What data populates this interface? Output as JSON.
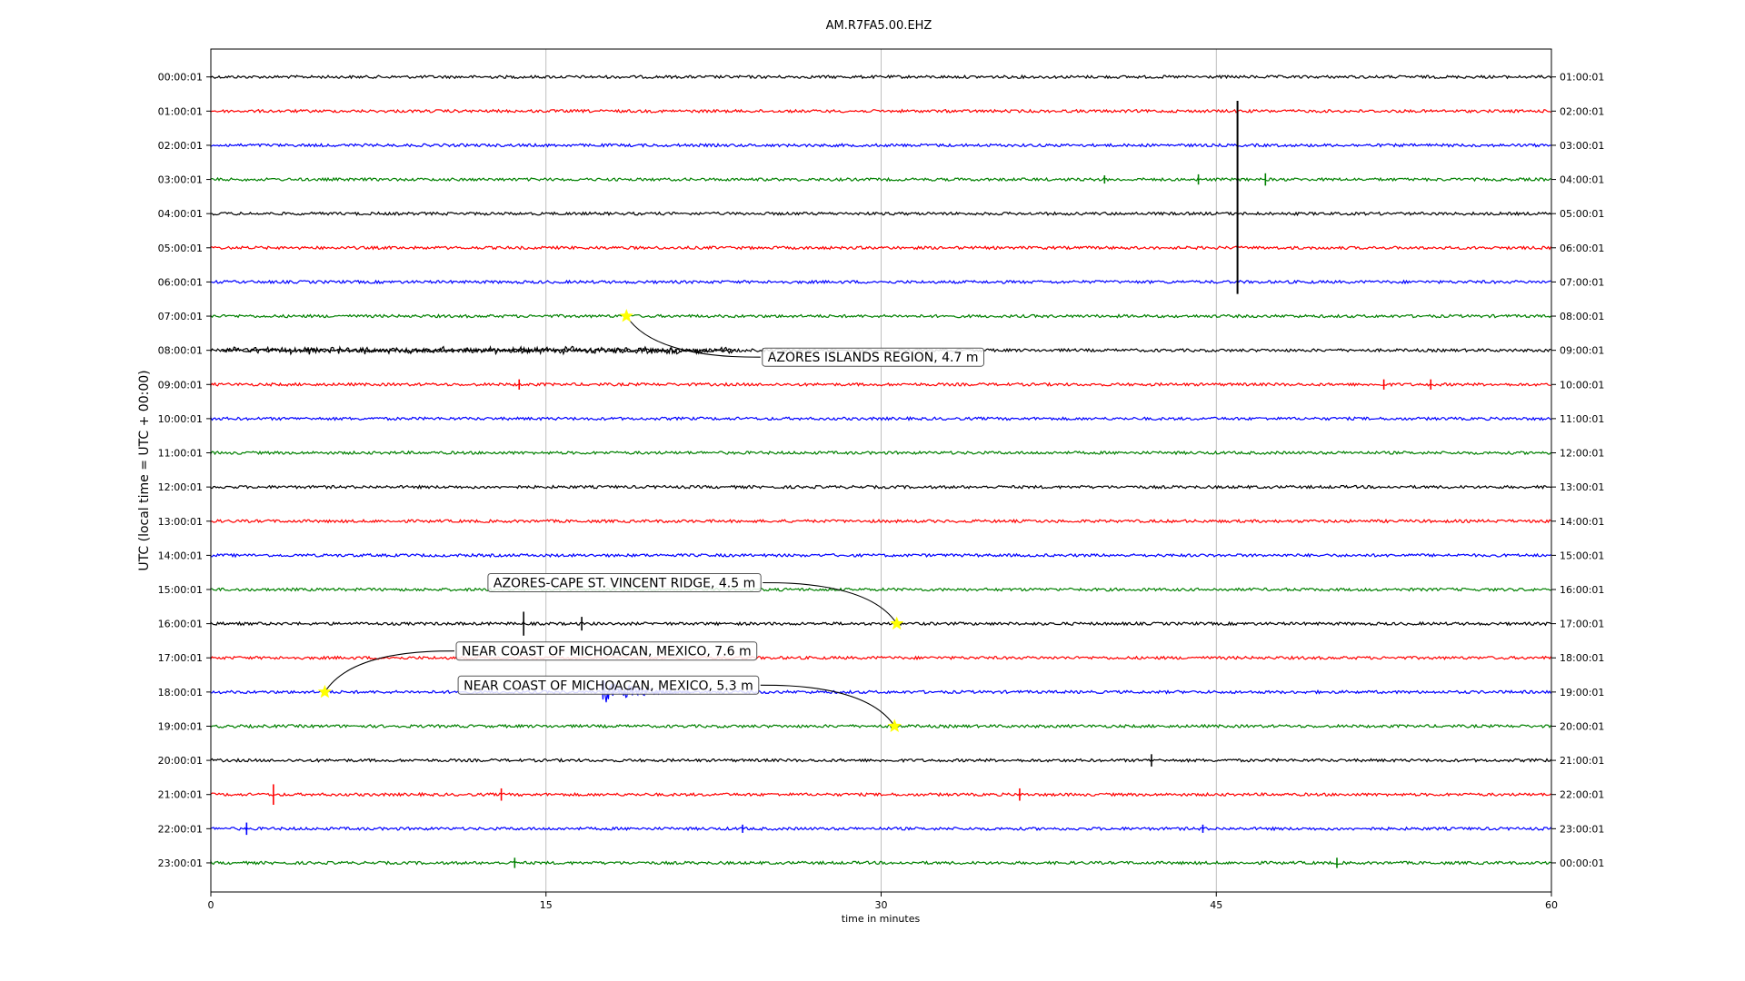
{
  "chart_data": {
    "type": "line",
    "title": "AM.R7FA5.00.EHZ",
    "xlabel": "time in minutes",
    "ylabel": "UTC (local time = UTC + 00:00)",
    "xlim": [
      0,
      60
    ],
    "xticks": [
      "0",
      "15",
      "30",
      "45",
      "60"
    ],
    "grid": "vertical",
    "left_labels": [
      "00:00:01",
      "01:00:01",
      "02:00:01",
      "03:00:01",
      "04:00:01",
      "05:00:01",
      "06:00:01",
      "07:00:01",
      "08:00:01",
      "09:00:01",
      "10:00:01",
      "11:00:01",
      "12:00:01",
      "13:00:01",
      "14:00:01",
      "15:00:01",
      "16:00:01",
      "17:00:01",
      "18:00:01",
      "19:00:01",
      "20:00:01",
      "21:00:01",
      "22:00:01",
      "23:00:01"
    ],
    "right_labels": [
      "01:00:01",
      "02:00:01",
      "03:00:01",
      "04:00:01",
      "05:00:01",
      "06:00:01",
      "07:00:01",
      "08:00:01",
      "09:00:01",
      "10:00:01",
      "11:00:01",
      "12:00:01",
      "13:00:01",
      "14:00:01",
      "15:00:01",
      "16:00:01",
      "17:00:01",
      "18:00:01",
      "19:00:01",
      "20:00:01",
      "21:00:01",
      "22:00:01",
      "23:00:01",
      "00:00:01"
    ],
    "trace_colors": [
      "#000000",
      "#ff0000",
      "#0000ff",
      "#008000"
    ],
    "star_color": "#ffff00",
    "spikes": [
      {
        "row": 1,
        "minute": 45.95,
        "from_row": 0.7,
        "to_row": 6.35,
        "color": "#000000"
      },
      {
        "row": 3,
        "minute": 40,
        "amp": 0.12,
        "color": "#008000"
      },
      {
        "row": 3,
        "minute": 44.2,
        "amp": 0.15,
        "color": "#008000"
      },
      {
        "row": 3,
        "minute": 47.2,
        "amp": 0.18,
        "color": "#008000"
      },
      {
        "row": 9,
        "minute": 13.8,
        "amp": 0.15,
        "color": "#ff0000"
      },
      {
        "row": 9,
        "minute": 52.5,
        "amp": 0.15,
        "color": "#ff0000"
      },
      {
        "row": 9,
        "minute": 54.6,
        "amp": 0.15,
        "color": "#ff0000"
      },
      {
        "row": 16,
        "minute": 14,
        "amp": 0.35,
        "color": "#000000"
      },
      {
        "row": 16,
        "minute": 16.6,
        "amp": 0.2,
        "color": "#000000"
      },
      {
        "row": 20,
        "minute": 42.1,
        "amp": 0.18,
        "color": "#000000"
      },
      {
        "row": 21,
        "minute": 2.8,
        "amp": 0.3,
        "color": "#ff0000"
      },
      {
        "row": 21,
        "minute": 13,
        "amp": 0.18,
        "color": "#ff0000"
      },
      {
        "row": 21,
        "minute": 36.2,
        "amp": 0.18,
        "color": "#ff0000"
      },
      {
        "row": 22,
        "minute": 1.6,
        "amp": 0.18,
        "color": "#0000ff"
      },
      {
        "row": 22,
        "minute": 23.8,
        "amp": 0.12,
        "color": "#0000ff"
      },
      {
        "row": 22,
        "minute": 44.4,
        "amp": 0.12,
        "color": "#0000ff"
      },
      {
        "row": 23,
        "minute": 13.6,
        "amp": 0.15,
        "color": "#008000"
      },
      {
        "row": 23,
        "minute": 50.4,
        "amp": 0.15,
        "color": "#008000"
      }
    ],
    "noisy_segments": [
      {
        "row": 8,
        "from": 0.5,
        "to": 23.5,
        "amp": 0.14,
        "color": "#000000"
      },
      {
        "row": 18,
        "from": 17.5,
        "to": 21.5,
        "amp": 0.45,
        "decay": true,
        "color": "#0000ff"
      }
    ],
    "events": [
      {
        "label": "AZORES ISLANDS REGION, 4.7 m",
        "row": 7,
        "minute": 18.6,
        "label_row": 8.2,
        "label_minute": 24.6,
        "label_anchor": "start"
      },
      {
        "label": "AZORES-CAPE ST. VINCENT RIDGE, 4.5 m",
        "row": 16,
        "minute": 30.7,
        "label_row": 14.8,
        "label_minute": 24.7,
        "label_anchor": "end"
      },
      {
        "label": "NEAR COAST OF MICHOACAN, MEXICO, 7.6 m",
        "row": 18,
        "minute": 5.1,
        "label_row": 16.8,
        "label_minute": 10.9,
        "label_anchor": "start"
      },
      {
        "label": "NEAR COAST OF MICHOACAN, MEXICO, 5.3 m",
        "row": 19,
        "minute": 30.6,
        "label_row": 17.8,
        "label_minute": 24.6,
        "label_anchor": "end"
      }
    ]
  }
}
